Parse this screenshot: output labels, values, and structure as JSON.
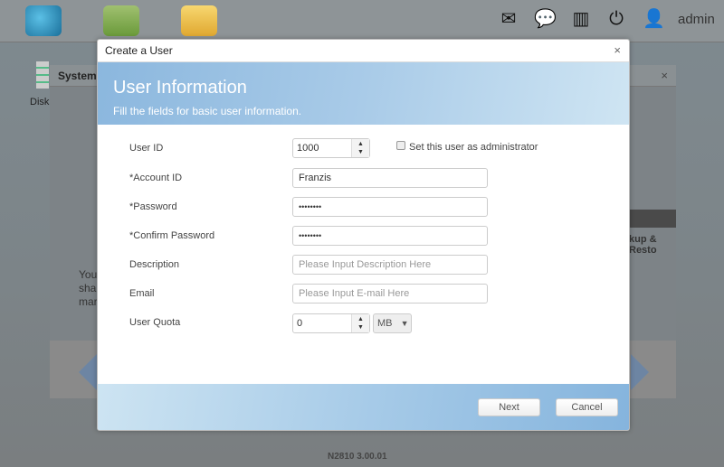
{
  "topbar": {
    "user": "admin",
    "icons": [
      "cloud-app-icon",
      "app-center-icon",
      "file-manager-icon",
      "mail-icon",
      "chat-icon",
      "monitor-icon",
      "power-icon",
      "user-icon"
    ]
  },
  "background": {
    "desktop_label": "Disk",
    "window_title": "System",
    "tab_label": "kup & Resto",
    "text_lines": [
      "You",
      "sha",
      "mar"
    ]
  },
  "dialog": {
    "title": "Create a User",
    "header_title": "User Information",
    "header_subtitle": "Fill the fields for basic user information.",
    "fields": {
      "user_id": {
        "label": "User ID",
        "value": "1000"
      },
      "admin_checkbox": {
        "label": "Set this user as administrator",
        "checked": false
      },
      "account_id": {
        "label": "*Account ID",
        "value": "Franzis"
      },
      "password": {
        "label": "*Password",
        "value": "••••••••"
      },
      "confirm_password": {
        "label": "*Confirm Password",
        "value": "••••••••"
      },
      "description": {
        "label": "Description",
        "placeholder": "Please Input Description Here",
        "value": ""
      },
      "email": {
        "label": "Email",
        "placeholder": "Please Input E-mail Here",
        "value": ""
      },
      "quota": {
        "label": "User Quota",
        "value": "0",
        "unit": "MB"
      }
    },
    "next_label": "Next",
    "cancel_label": "Cancel"
  },
  "footer": {
    "version": "N2810   3.00.01"
  }
}
